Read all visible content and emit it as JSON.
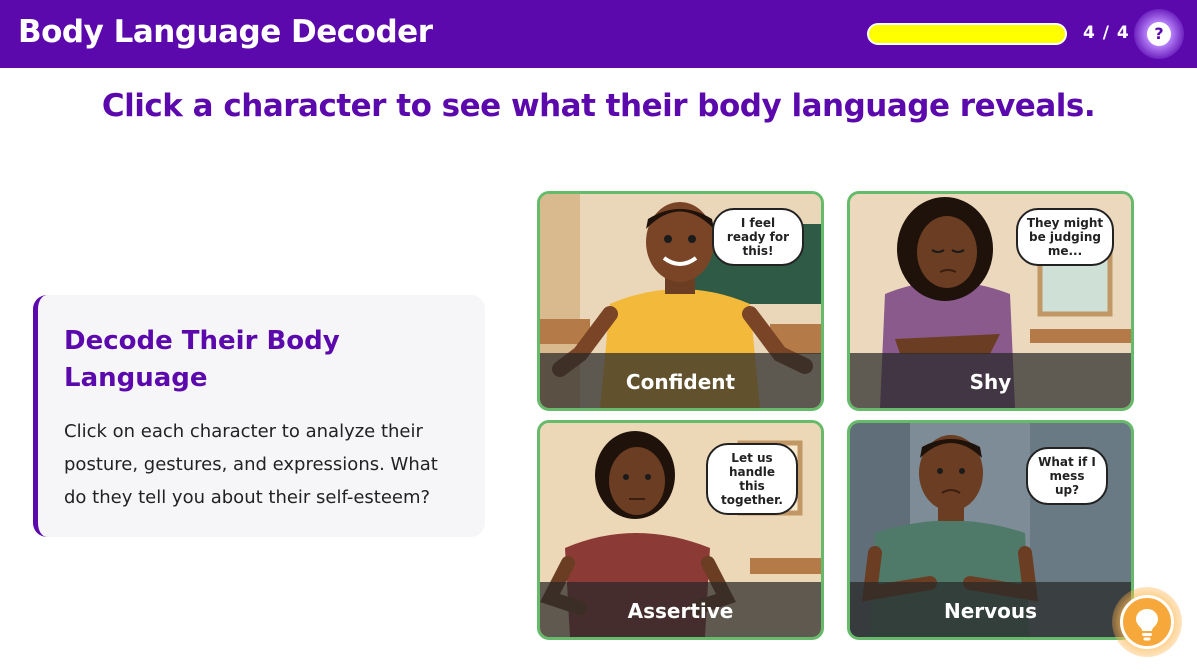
{
  "header": {
    "title": "Body Language Decoder",
    "progress_label": "4 / 4",
    "progress_fraction": 1.0,
    "help_icon": "question-circle-icon",
    "help_symbol": "?"
  },
  "instruction": "Click a character to see what their body language reveals.",
  "info_card": {
    "title": "Decode Their Body Language",
    "body": "Click on each character to analyze their posture, gestures, and expressions. What do they tell you about their self-esteem?"
  },
  "characters": [
    {
      "label": "Confident",
      "bubble": "I feel ready for this!",
      "shirt_color": "#f2b93b"
    },
    {
      "label": "Shy",
      "bubble": "They might be judging me...",
      "shirt_color": "#8a5a8c"
    },
    {
      "label": "Assertive",
      "bubble": "Let us handle this together.",
      "shirt_color": "#8b3a36"
    },
    {
      "label": "Nervous",
      "bubble": "What if I mess up?",
      "shirt_color": "#4f7a6a"
    }
  ],
  "hint_button": {
    "icon": "lightbulb-icon"
  },
  "colors": {
    "brand_purple": "#5b08ad",
    "progress_yellow": "#ffff00",
    "card_border": "#66bb6a",
    "hint_orange": "#f7a83b"
  }
}
